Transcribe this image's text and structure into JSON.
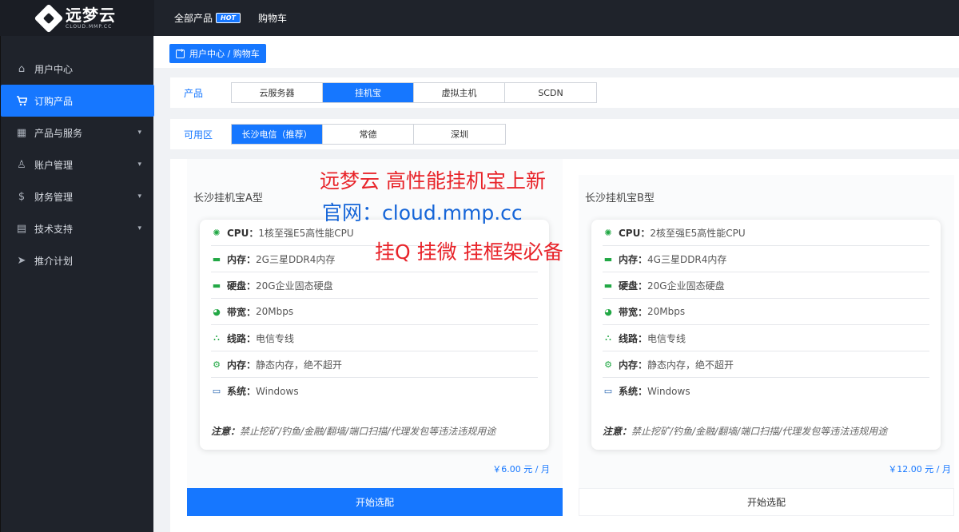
{
  "brand": {
    "name": "远梦云",
    "sub": "CLOUD.MMP.CC"
  },
  "topnav": {
    "all_products": "全部产品",
    "hot": "HOT",
    "cart": "购物车"
  },
  "sidebar": {
    "items": [
      {
        "label": "用户中心",
        "icon": "home-icon"
      },
      {
        "label": "订购产品",
        "icon": "cart-icon"
      },
      {
        "label": "产品与服务",
        "icon": "grid-icon"
      },
      {
        "label": "账户管理",
        "icon": "user-icon"
      },
      {
        "label": "财务管理",
        "icon": "dollar-icon"
      },
      {
        "label": "技术支持",
        "icon": "ticket-icon"
      },
      {
        "label": "推介计划",
        "icon": "send-icon"
      }
    ]
  },
  "breadcrumb": "用户中心 / 购物车",
  "filters": {
    "product_label": "产品",
    "products": [
      "云服务器",
      "挂机宝",
      "虚拟主机",
      "SCDN"
    ],
    "selected_product": "挂机宝",
    "zone_label": "可用区",
    "zones": [
      "长沙电信（推荐）",
      "常德",
      "深圳"
    ],
    "selected_zone": "长沙电信（推荐）"
  },
  "promo": {
    "line1": "远梦云 高性能挂机宝上新",
    "line2": "官网：cloud.mmp.cc",
    "line3": "挂Q 挂微 挂框架必备"
  },
  "cards": [
    {
      "title": "长沙挂机宝A型",
      "specs": [
        {
          "key": "CPU：",
          "val": "1核至强E5高性能CPU"
        },
        {
          "key": "内存：",
          "val": "2G三星DDR4内存"
        },
        {
          "key": "硬盘：",
          "val": "20G企业固态硬盘"
        },
        {
          "key": "带宽：",
          "val": "20Mbps"
        },
        {
          "key": "线路：",
          "val": "电信专线"
        },
        {
          "key": "内存：",
          "val": "静态内存，绝不超开"
        },
        {
          "key": "系统：",
          "val": "Windows"
        }
      ],
      "note_key": "注意：",
      "note": "禁止挖矿/钓鱼/金融/翻墙/端口扫描/代理发包等违法违规用途",
      "price": "￥6.00 元 / 月",
      "button": "开始选配"
    },
    {
      "title": "长沙挂机宝B型",
      "specs": [
        {
          "key": "CPU：",
          "val": "2核至强E5高性能CPU"
        },
        {
          "key": "内存：",
          "val": "4G三星DDR4内存"
        },
        {
          "key": "硬盘：",
          "val": "20G企业固态硬盘"
        },
        {
          "key": "带宽：",
          "val": "20Mbps"
        },
        {
          "key": "线路：",
          "val": "电信专线"
        },
        {
          "key": "内存：",
          "val": "静态内存，绝不超开"
        },
        {
          "key": "系统：",
          "val": "Windows"
        }
      ],
      "note_key": "注意：",
      "note": "禁止挖矿/钓鱼/金融/翻墙/端口扫描/代理发包等违法违规用途",
      "price": "￥12.00 元 / 月",
      "button": "开始选配"
    }
  ],
  "colors": {
    "accent": "#1677ff",
    "sidebar_bg": "#1f232b",
    "promo_red": "#e8242a",
    "promo_blue": "#1565d8"
  }
}
